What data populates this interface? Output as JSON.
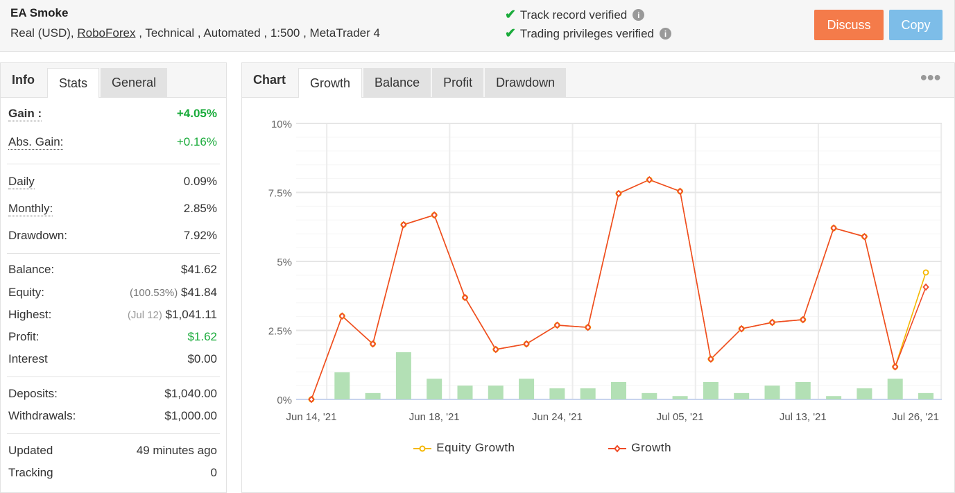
{
  "header": {
    "title": "EA Smoke",
    "subtitle_prefix": "Real (USD),",
    "broker": "RoboForex",
    "subtitle_suffix": " , Technical , Automated , 1:500 , MetaTrader 4",
    "verifications": [
      "Track record verified",
      "Trading privileges verified"
    ],
    "discuss_label": "Discuss",
    "copy_label": "Copy",
    "discuss_color": "#f47b4a",
    "copy_color": "#7dbde8"
  },
  "left_tabs": {
    "label": "Info",
    "tabs": [
      "Stats",
      "General"
    ],
    "active": "Stats"
  },
  "stats": {
    "gain": {
      "label": "Gain :",
      "value": "+4.05%"
    },
    "abs_gain": {
      "label": "Abs. Gain:",
      "value": "+0.16%"
    },
    "daily": {
      "label": "Daily",
      "value": "0.09%"
    },
    "monthly": {
      "label": "Monthly:",
      "value": "2.85%"
    },
    "drawdown": {
      "label": "Drawdown:",
      "value": "7.92%"
    },
    "balance": {
      "label": "Balance:",
      "value": "$41.62"
    },
    "equity": {
      "label": "Equity:",
      "note": "(100.53%)",
      "value": "$41.84"
    },
    "highest": {
      "label": "Highest:",
      "note": "(Jul 12)",
      "value": "$1,041.11"
    },
    "profit": {
      "label": "Profit:",
      "value": "$1.62"
    },
    "interest": {
      "label": "Interest",
      "value": "$0.00"
    },
    "deposits": {
      "label": "Deposits:",
      "value": "$1,040.00"
    },
    "withdrawals": {
      "label": "Withdrawals:",
      "value": "$1,000.00"
    },
    "updated": {
      "label": "Updated",
      "value": "49 minutes ago"
    },
    "tracking": {
      "label": "Tracking",
      "value": "0"
    }
  },
  "chart_tabs": {
    "label": "Chart",
    "tabs": [
      "Growth",
      "Balance",
      "Profit",
      "Drawdown"
    ],
    "active": "Growth",
    "more_icon": "ellipsis-icon"
  },
  "chart_data": {
    "type": "line",
    "ylim": [
      0,
      10
    ],
    "y_ticks": [
      "0%",
      "2.5%",
      "5%",
      "7.5%",
      "10%"
    ],
    "x_ticks": [
      {
        "index": 0,
        "label": "Jun 14, '21"
      },
      {
        "index": 4,
        "label": "Jun 18, '21"
      },
      {
        "index": 8,
        "label": "Jun 24, '21"
      },
      {
        "index": 12,
        "label": "Jul 05, '21"
      },
      {
        "index": 16,
        "label": "Jul 13, '21"
      },
      {
        "index": 20,
        "label": "Jul 26, '21"
      }
    ],
    "grid": true,
    "legend_position": "bottom",
    "series": [
      {
        "name": "Equity Growth",
        "color": "#f5b800",
        "marker": "circle",
        "values": [
          0,
          3.02,
          2.01,
          6.33,
          6.68,
          3.69,
          1.81,
          2.01,
          2.69,
          2.61,
          7.46,
          7.96,
          7.54,
          1.46,
          2.56,
          2.79,
          2.89,
          6.21,
          5.9,
          1.18,
          4.6
        ]
      },
      {
        "name": "Growth",
        "color": "#ef4a26",
        "marker": "diamond",
        "values": [
          0,
          3.02,
          2.01,
          6.33,
          6.68,
          3.69,
          1.81,
          2.01,
          2.69,
          2.61,
          7.46,
          7.96,
          7.54,
          1.46,
          2.56,
          2.79,
          2.89,
          6.21,
          5.9,
          1.18,
          4.07
        ]
      }
    ],
    "bars": {
      "color": "#b3e0b5",
      "start_index": 1,
      "values": [
        0.98,
        0.23,
        1.71,
        0.75,
        0.5,
        0.5,
        0.75,
        0.4,
        0.4,
        0.63,
        0.23,
        0.12,
        0.63,
        0.23,
        0.5,
        0.63,
        0.12,
        0.4,
        0.75,
        0.23
      ]
    }
  }
}
